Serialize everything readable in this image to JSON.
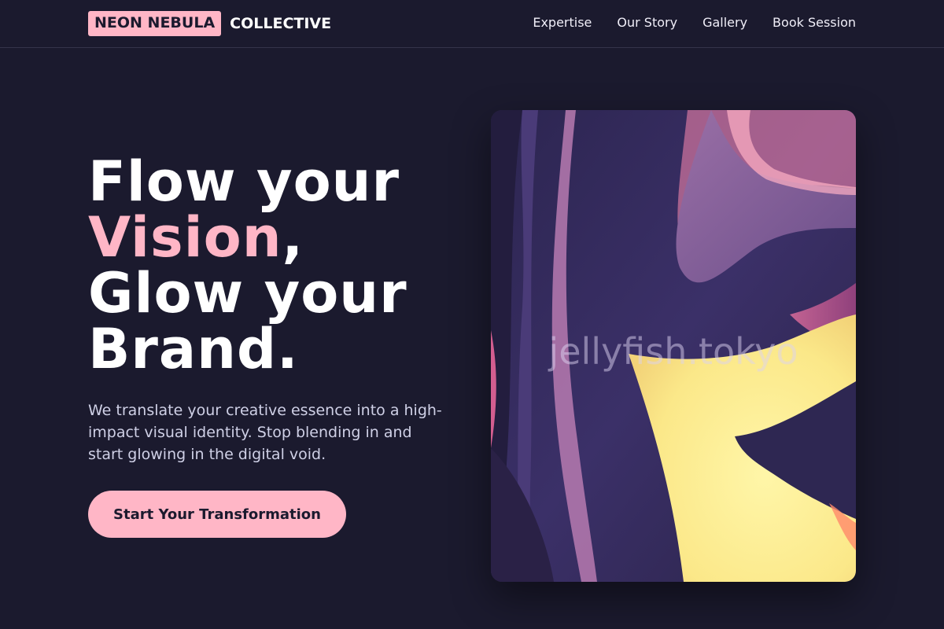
{
  "brand": {
    "badge": "NEON NEBULA",
    "rest": "COLLECTIVE"
  },
  "nav": {
    "items": [
      "Expertise",
      "Our Story",
      "Gallery",
      "Book Session"
    ]
  },
  "hero": {
    "title_line1": "Flow your",
    "title_accent": "Vision",
    "title_comma": ",",
    "title_line3": "Glow your",
    "title_line4": "Brand.",
    "subtitle": "We translate your creative essence into a high-impact visual identity. Stop blending in and start glowing in the digital void.",
    "cta_label": "Start Your Transformation"
  },
  "artwork": {
    "watermark": "jellyfish.tokyo"
  },
  "colors": {
    "background": "#1b1a2e",
    "accent": "#ffb6c6",
    "text": "#ffffff",
    "muted_text": "#cfd0e6"
  }
}
